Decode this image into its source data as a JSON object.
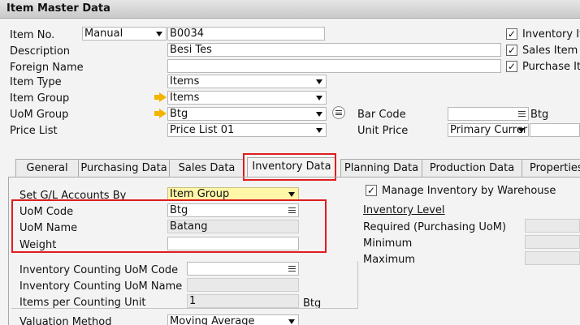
{
  "window": {
    "title": "Item Master Data"
  },
  "header": {
    "item_no": {
      "label": "Item No.",
      "series": "Manual",
      "value": "B0034"
    },
    "description": {
      "label": "Description",
      "value": "Besi Tes"
    },
    "foreign_name": {
      "label": "Foreign Name",
      "value": ""
    },
    "item_type": {
      "label": "Item Type",
      "value": "Items"
    },
    "item_group": {
      "label": "Item Group",
      "value": "Items"
    },
    "uom_group": {
      "label": "UoM Group",
      "value": "Btg"
    },
    "price_list": {
      "label": "Price List",
      "value": "Price List 01"
    },
    "bar_code": {
      "label": "Bar Code",
      "value": "",
      "unit": "Btg"
    },
    "unit_price": {
      "label": "Unit Price",
      "currency": "Primary Currer",
      "value": ""
    },
    "checks": [
      {
        "label": "Inventory It",
        "checked": true
      },
      {
        "label": "Sales Item",
        "checked": true
      },
      {
        "label": "Purchase It",
        "checked": true
      }
    ]
  },
  "tabs": [
    {
      "label": "General"
    },
    {
      "label": "Purchasing Data"
    },
    {
      "label": "Sales Data"
    },
    {
      "label": "Inventory Data"
    },
    {
      "label": "Planning Data"
    },
    {
      "label": "Production Data"
    },
    {
      "label": "Properties"
    }
  ],
  "inventory": {
    "set_gl": {
      "label": "Set G/L Accounts By",
      "value": "Item Group"
    },
    "uom_code": {
      "label": "UoM Code",
      "value": "Btg"
    },
    "uom_name": {
      "label": "UoM Name",
      "value": "Batang"
    },
    "weight": {
      "label": "Weight",
      "value": ""
    },
    "count_uom_code": {
      "label": "Inventory Counting UoM Code",
      "value": ""
    },
    "count_uom_name": {
      "label": "Inventory Counting UoM Name",
      "value": ""
    },
    "items_per_count": {
      "label": "Items per Counting Unit",
      "value": "1",
      "unit": "Btg"
    },
    "valuation": {
      "label": "Valuation Method",
      "value": "Moving Average"
    },
    "manage_wh": {
      "label": "Manage Inventory by Warehouse",
      "checked": true
    },
    "inventory_level": {
      "title": "Inventory Level",
      "required": "Required (Purchasing UoM)",
      "minimum": "Minimum",
      "maximum": "Maximum"
    }
  }
}
